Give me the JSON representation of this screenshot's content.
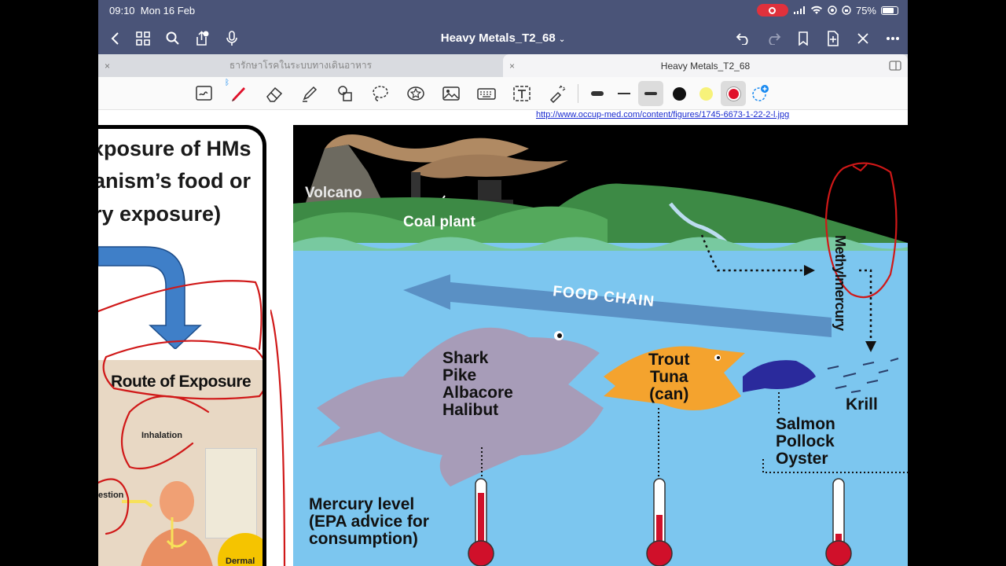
{
  "status": {
    "time": "09:10",
    "date": "Mon 16 Feb",
    "battery": "75%"
  },
  "nav": {
    "title": "Heavy Metals_T2_68"
  },
  "tabs": [
    {
      "label": "ธารักษาโรคในระบบทางเดินอาหาร",
      "close": "×"
    },
    {
      "label": "Heavy Metals_T2_68",
      "close": "×"
    }
  ],
  "toolbar": {
    "bluetooth": "ᛒ",
    "colors": {
      "black": "#111111",
      "yellow": "#f7f27a",
      "red": "#e0102a",
      "accent": "#1a8af0"
    }
  },
  "page": {
    "url": "http://www.occup-med.com/content/figures/1745-6673-1-22-2-l.jpg",
    "slide_left": {
      "heading": [
        "xposure of HMs",
        "anism’s food or",
        "ry exposure)"
      ],
      "route_title": "Route of Exposure",
      "inhalation": "Inhalation",
      "ingestion": "estion",
      "dermal": "Dermal"
    },
    "illustration": {
      "volcano": "Volcano",
      "coal_plant": "Coal plant",
      "methylmercury": "Methylmercury",
      "food_chain": "FOOD CHAIN",
      "big_fish": [
        "Shark",
        "Pike",
        "Albacore",
        "Halibut"
      ],
      "mid_fish": [
        "Trout",
        "Tuna",
        "(can)"
      ],
      "small_fish": [
        "Salmon",
        "Pollock",
        "Oyster"
      ],
      "krill": "Krill",
      "mercury_level": [
        "Mercury level",
        "(EPA advice for",
        "consumption)"
      ],
      "thermometer_levels": [
        0.9,
        0.55,
        0.25
      ]
    }
  }
}
